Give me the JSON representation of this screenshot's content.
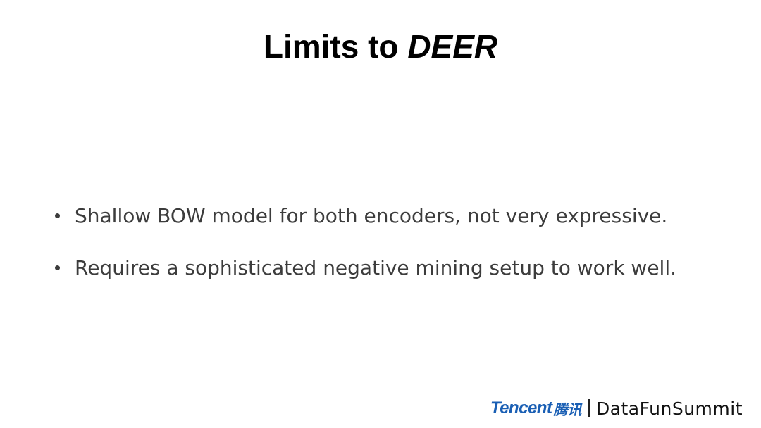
{
  "slide": {
    "title_plain": "Limits to ",
    "title_emphasis": "DEER",
    "bullets": [
      "Shallow BOW model for both encoders, not very expressive.",
      "Requires a sophisticated negative mining setup to work well."
    ]
  },
  "footer": {
    "tencent_en": "Tencent",
    "tencent_cn": "腾讯",
    "brand": "DataFunSummit",
    "tencent_color": "#1a5fb4"
  }
}
